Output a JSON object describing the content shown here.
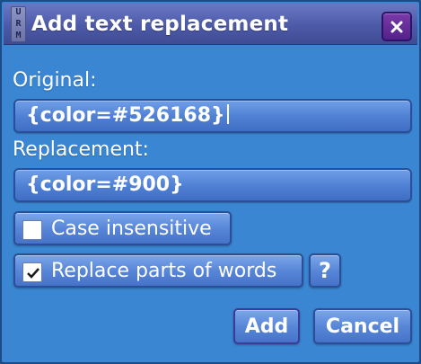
{
  "window": {
    "title": "Add text replacement",
    "app_icon_letters": [
      "U",
      "R",
      "M"
    ],
    "close_icon": "close-x-icon"
  },
  "original": {
    "label": "Original:",
    "value": "{color=#526168}"
  },
  "replacement": {
    "label": "Replacement:",
    "value": "{color=#900}"
  },
  "options": {
    "case_insensitive": {
      "label": "Case insensitive",
      "checked": false
    },
    "replace_parts": {
      "label": "Replace parts of words",
      "checked": true
    },
    "help_label": "?"
  },
  "actions": {
    "add_label": "Add",
    "cancel_label": "Cancel"
  },
  "colors": {
    "dialog_bg": "#3a86d2",
    "titlebar": "#4d5aa8",
    "close_button": "#6a2e9c",
    "field_bg": "#4f7fd3",
    "text": "#ffffff"
  }
}
